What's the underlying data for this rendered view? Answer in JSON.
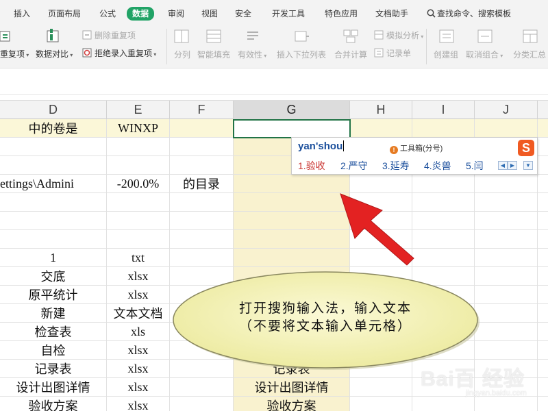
{
  "tabs": [
    {
      "label": "插入",
      "active": false
    },
    {
      "label": "页面布局",
      "active": false
    },
    {
      "label": "公式",
      "active": false
    },
    {
      "label": "数据",
      "active": true
    },
    {
      "label": "审阅",
      "active": false
    },
    {
      "label": "视图",
      "active": false
    },
    {
      "label": "安全",
      "active": false
    },
    {
      "label": "开发工具",
      "active": false
    },
    {
      "label": "特色应用",
      "active": false
    },
    {
      "label": "文档助手",
      "active": false
    }
  ],
  "search_command": "查找命令、搜索模板",
  "ribbon": {
    "dup_items": "重复项",
    "data_compare": "数据对比",
    "remove_dup": "删除重复项",
    "reject_dup": "拒绝录入重复项",
    "split": "分列",
    "smart_fill": "智能填充",
    "validity": "有效性",
    "insert_dropdown": "插入下拉列表",
    "merge_calc": "合并计算",
    "simulate": "模拟分析",
    "record_form": "记录单",
    "create_group": "创建组",
    "ungroup": "取消组合",
    "subtotal": "分类汇总"
  },
  "columns": [
    "D",
    "E",
    "F",
    "G",
    "H",
    "I",
    "J"
  ],
  "selected_column": "G",
  "rows": [
    {
      "d": "中的卷是",
      "e": "WINXP",
      "f": "",
      "g": "",
      "yellow": true
    },
    {
      "d": "",
      "e": "",
      "f": "",
      "g": "",
      "yellow": false
    },
    {
      "d": "",
      "e": "",
      "f": "",
      "g": "",
      "yellow": false
    },
    {
      "d": "ettings\\Admini",
      "e": "-200.0%",
      "f": "的目录",
      "g": "",
      "yellow": false
    },
    {
      "d": "",
      "e": "",
      "f": "",
      "g": "",
      "yellow": false
    },
    {
      "d": "",
      "e": "",
      "f": "",
      "g": "",
      "yellow": false
    },
    {
      "d": "",
      "e": "",
      "f": "",
      "g": "",
      "yellow": false
    },
    {
      "d": "1",
      "e": "txt",
      "f": "",
      "g": "",
      "yellow": false
    },
    {
      "d": "交底",
      "e": "xlsx",
      "f": "",
      "g": "",
      "yellow": false
    },
    {
      "d": "原平统计",
      "e": "xlsx",
      "f": "",
      "g": "",
      "yellow": false
    },
    {
      "d": "新建",
      "e": "文本文档",
      "f": "",
      "g": "",
      "yellow": false
    },
    {
      "d": "检查表",
      "e": "xls",
      "f": "",
      "g": "",
      "yellow": false
    },
    {
      "d": "自检",
      "e": "xlsx",
      "f": "",
      "g": "",
      "yellow": false
    },
    {
      "d": "记录表",
      "e": "xlsx",
      "f": "",
      "g": "记录表",
      "yellow": false
    },
    {
      "d": "设计出图详情",
      "e": "xlsx",
      "f": "",
      "g": "设计出图详情",
      "yellow": false
    },
    {
      "d": "验收方案",
      "e": "xlsx",
      "f": "",
      "g": "验收方案",
      "yellow": false
    }
  ],
  "ime": {
    "composition": "yan'shou",
    "toolbox": "工具箱(分号)",
    "logo": "S",
    "candidates": [
      "1.验收",
      "2.严守",
      "3.延寿",
      "4.炎兽",
      "5.闫"
    ]
  },
  "callout": {
    "line1": "打开搜狗输入法，输入文本",
    "line2": "（不要将文本输入单元格）"
  },
  "watermark": {
    "main": "Bai百 经验",
    "sub": "jingyan.baidu.com"
  },
  "colors": {
    "accent": "#21a366",
    "arrow": "#e32222",
    "bubble": "#f5f2c2"
  }
}
